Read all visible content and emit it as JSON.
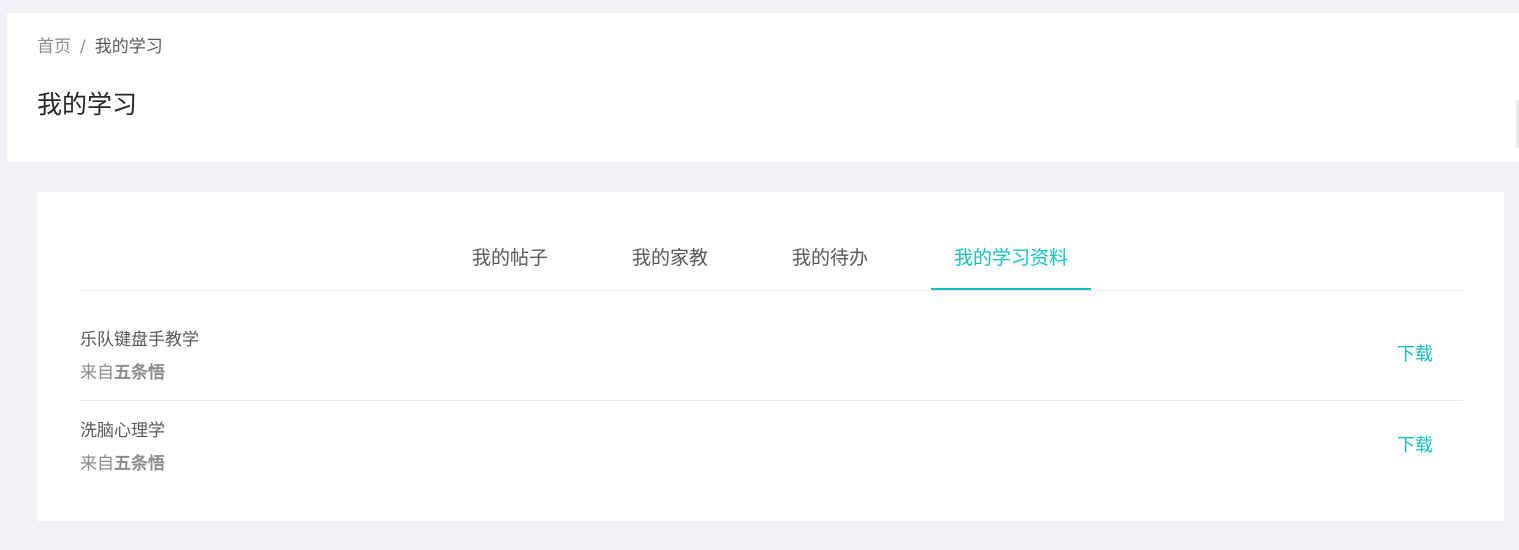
{
  "breadcrumb": {
    "home": "首页",
    "separator": "/",
    "current": "我的学习"
  },
  "page": {
    "title": "我的学习"
  },
  "tabs": [
    {
      "label": "我的帖子",
      "active": false
    },
    {
      "label": "我的家教",
      "active": false
    },
    {
      "label": "我的待办",
      "active": false
    },
    {
      "label": "我的学习资料",
      "active": true
    }
  ],
  "materials": [
    {
      "title": "乐队键盘手教学",
      "source_prefix": "来自",
      "author": "五条悟",
      "action": "下载"
    },
    {
      "title": "洗脑心理学",
      "source_prefix": "来自",
      "author": "五条悟",
      "action": "下载"
    }
  ],
  "colors": {
    "accent": "#13c2c2",
    "background": "#f0f2f5"
  }
}
